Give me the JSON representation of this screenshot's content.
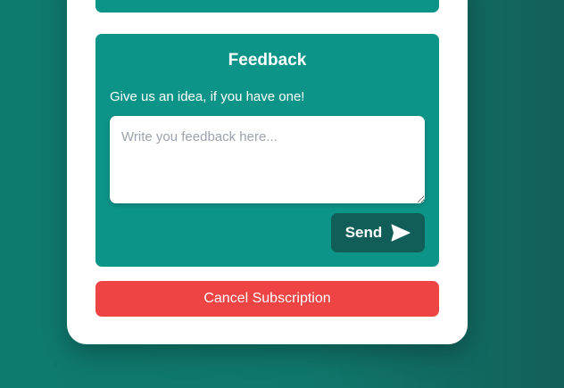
{
  "colors": {
    "background_start": "#0f7a70",
    "background_end": "#126058",
    "panel": "#0d9488",
    "send_button": "#115e59",
    "cancel_button": "#ef4444",
    "card": "#ffffff"
  },
  "feedback": {
    "title": "Feedback",
    "subtitle": "Give us an idea, if you have one!",
    "textarea_value": "",
    "textarea_placeholder": "Write you feedback here...",
    "send_label": "Send",
    "send_icon": "paper-plane-icon"
  },
  "subscription": {
    "cancel_label": "Cancel Subscription"
  }
}
